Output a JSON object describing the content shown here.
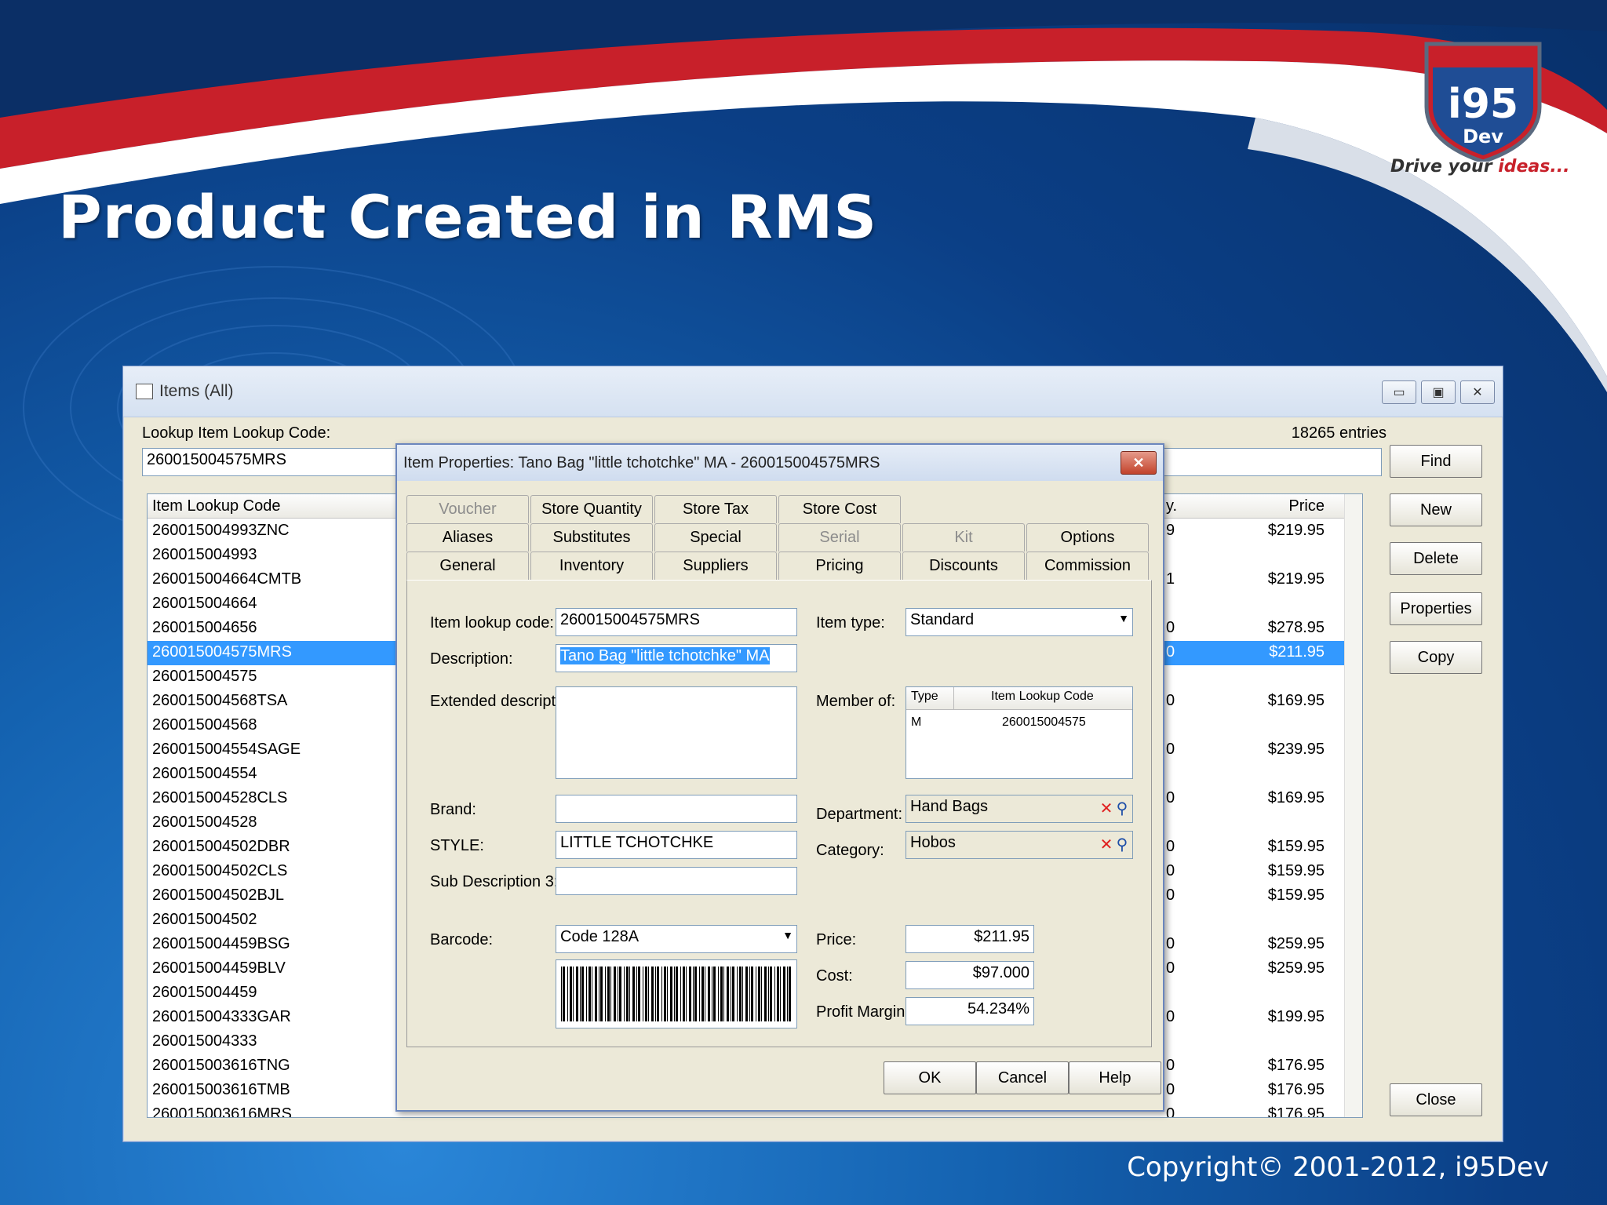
{
  "slide": {
    "title": "Product Created in RMS",
    "copyright": "Copyright© 2001-2012, i95Dev",
    "logo": {
      "name": "i95",
      "sub": "Dev",
      "tagline_a": "Drive your ",
      "tagline_b": "ideas..."
    },
    "colors": {
      "red": "#c8202a",
      "blue": "#0b3f86"
    }
  },
  "window": {
    "title": "Items (All)",
    "lookup_label": "Lookup Item Lookup Code:",
    "lookup_value": "260015004575MRS",
    "entries": "18265 entries",
    "buttons": {
      "find": "Find",
      "new": "New",
      "delete": "Delete",
      "properties": "Properties",
      "copy": "Copy",
      "close": "Close"
    },
    "columns": {
      "code": "Item Lookup Code",
      "qty": "y.",
      "price": "Price"
    },
    "rows": [
      {
        "code": "260015004993ZNC",
        "q": "9",
        "price": "$219.95"
      },
      {
        "code": "260015004993",
        "q": "",
        "price": ""
      },
      {
        "code": "260015004664CMTB",
        "q": "1",
        "price": "$219.95"
      },
      {
        "code": "260015004664",
        "q": "",
        "price": ""
      },
      {
        "code": "260015004656",
        "q": "0",
        "price": "$278.95"
      },
      {
        "code": "260015004575MRS",
        "q": "0",
        "price": "$211.95"
      },
      {
        "code": "260015004575",
        "q": "",
        "price": ""
      },
      {
        "code": "260015004568TSA",
        "q": "0",
        "price": "$169.95"
      },
      {
        "code": "260015004568",
        "q": "",
        "price": ""
      },
      {
        "code": "260015004554SAGE",
        "q": "0",
        "price": "$239.95"
      },
      {
        "code": "260015004554",
        "q": "",
        "price": ""
      },
      {
        "code": "260015004528CLS",
        "q": "0",
        "price": "$169.95"
      },
      {
        "code": "260015004528",
        "q": "",
        "price": ""
      },
      {
        "code": "260015004502DBR",
        "q": "0",
        "price": "$159.95"
      },
      {
        "code": "260015004502CLS",
        "q": "0",
        "price": "$159.95"
      },
      {
        "code": "260015004502BJL",
        "q": "0",
        "price": "$159.95"
      },
      {
        "code": "260015004502",
        "q": "",
        "price": ""
      },
      {
        "code": "260015004459BSG",
        "q": "0",
        "price": "$259.95"
      },
      {
        "code": "260015004459BLV",
        "q": "0",
        "price": "$259.95"
      },
      {
        "code": "260015004459",
        "q": "",
        "price": ""
      },
      {
        "code": "260015004333GAR",
        "q": "0",
        "price": "$199.95"
      },
      {
        "code": "260015004333",
        "q": "",
        "price": ""
      },
      {
        "code": "260015003616TNG",
        "q": "0",
        "price": "$176.95"
      },
      {
        "code": "260015003616TMB",
        "q": "0",
        "price": "$176.95"
      },
      {
        "code": "260015003616MRS",
        "q": "0",
        "price": "$176.95"
      }
    ]
  },
  "dialog": {
    "title": "Item Properties: Tano Bag \"little tchotchke\" MA - 260015004575MRS",
    "tabs_row1": [
      "Voucher",
      "Store Quantity",
      "Store Tax",
      "Store Cost"
    ],
    "tabs_row2": [
      "Aliases",
      "Substitutes",
      "Special",
      "Serial",
      "Kit",
      "Options"
    ],
    "tabs_row3": [
      "General",
      "Inventory",
      "Suppliers",
      "Pricing",
      "Discounts",
      "Commission"
    ],
    "labels": {
      "lookup": "Item lookup code:",
      "description": "Description:",
      "extended": "Extended description:",
      "brand": "Brand:",
      "style": "STYLE:",
      "subdesc": "Sub Description 3:",
      "barcode": "Barcode:",
      "item_type": "Item type:",
      "member_of": "Member of:",
      "department": "Department:",
      "category": "Category:",
      "price": "Price:",
      "cost": "Cost:",
      "margin": "Profit Margin:"
    },
    "values": {
      "lookup": "260015004575MRS",
      "description": "Tano Bag \"little tchotchke\" MA",
      "extended": "",
      "brand": "",
      "style": "LITTLE TCHOTCHKE",
      "subdesc": "",
      "barcode": "Code 128A",
      "item_type": "Standard",
      "department": "Hand Bags",
      "category": "Hobos",
      "price": "$211.95",
      "cost": "$97.000",
      "margin": "54.234%"
    },
    "member_table": {
      "col_type": "Type",
      "col_code": "Item Lookup Code",
      "row_type": "M",
      "row_code": "260015004575"
    },
    "buttons": {
      "ok": "OK",
      "cancel": "Cancel",
      "help": "Help",
      "close_x": "✕"
    }
  }
}
